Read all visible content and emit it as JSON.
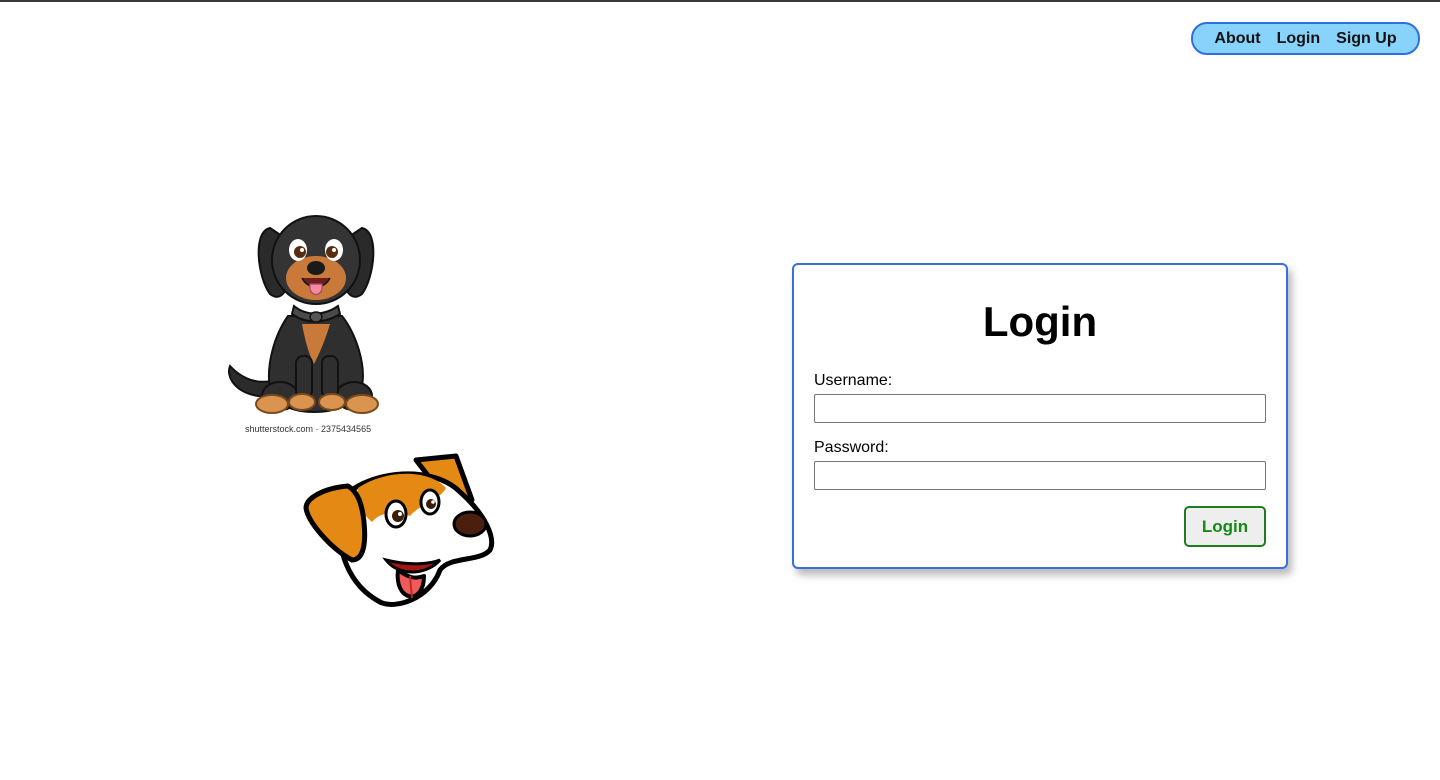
{
  "nav": {
    "about": "About",
    "login": "Login",
    "signup": "Sign Up"
  },
  "images": {
    "watermark": "shutterstock.com · 2375434565"
  },
  "login_form": {
    "title": "Login",
    "username_label": "Username:",
    "username_value": "",
    "password_label": "Password:",
    "password_value": "",
    "submit_label": "Login"
  },
  "colors": {
    "nav_background": "#87d3fb",
    "nav_border": "#2f6fe0",
    "card_border": "#3a6de0",
    "button_text": "#138a13",
    "button_border": "#1e7d1e"
  }
}
